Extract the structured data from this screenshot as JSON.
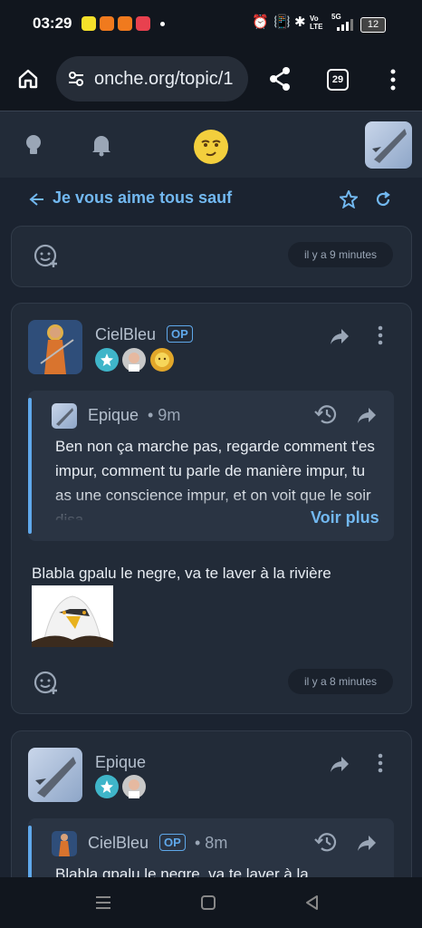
{
  "status": {
    "time": "03:29",
    "battery": "12",
    "network": "5G",
    "volte": "Vo LTE"
  },
  "browser": {
    "url": "onche.org/topic/1",
    "tab_count": "29"
  },
  "topic": {
    "title": "Je vous aime tous sauf"
  },
  "card1": {
    "timestamp": "il y a 9 minutes"
  },
  "post1": {
    "author": "CielBleu",
    "op_label": "OP",
    "quote": {
      "author": "Epique",
      "time": "• 9m",
      "text": "Ben non ça marche pas, regarde comment t'es impur, comment tu parle de manière impur, tu as une conscience impur, et on voit que le soir disa",
      "more": "Voir plus"
    },
    "body": "Blabla gpalu le negre, va te laver à la rivière",
    "timestamp": "il y a 8 minutes"
  },
  "post2": {
    "author": "Epique",
    "quote": {
      "author": "CielBleu",
      "op_label": "OP",
      "time": "• 8m",
      "text": "Blabla gpalu le negre, va te laver à la"
    }
  },
  "colors": {
    "accent": "#5fa8ea",
    "background": "#1b2330",
    "card": "#222b38"
  }
}
